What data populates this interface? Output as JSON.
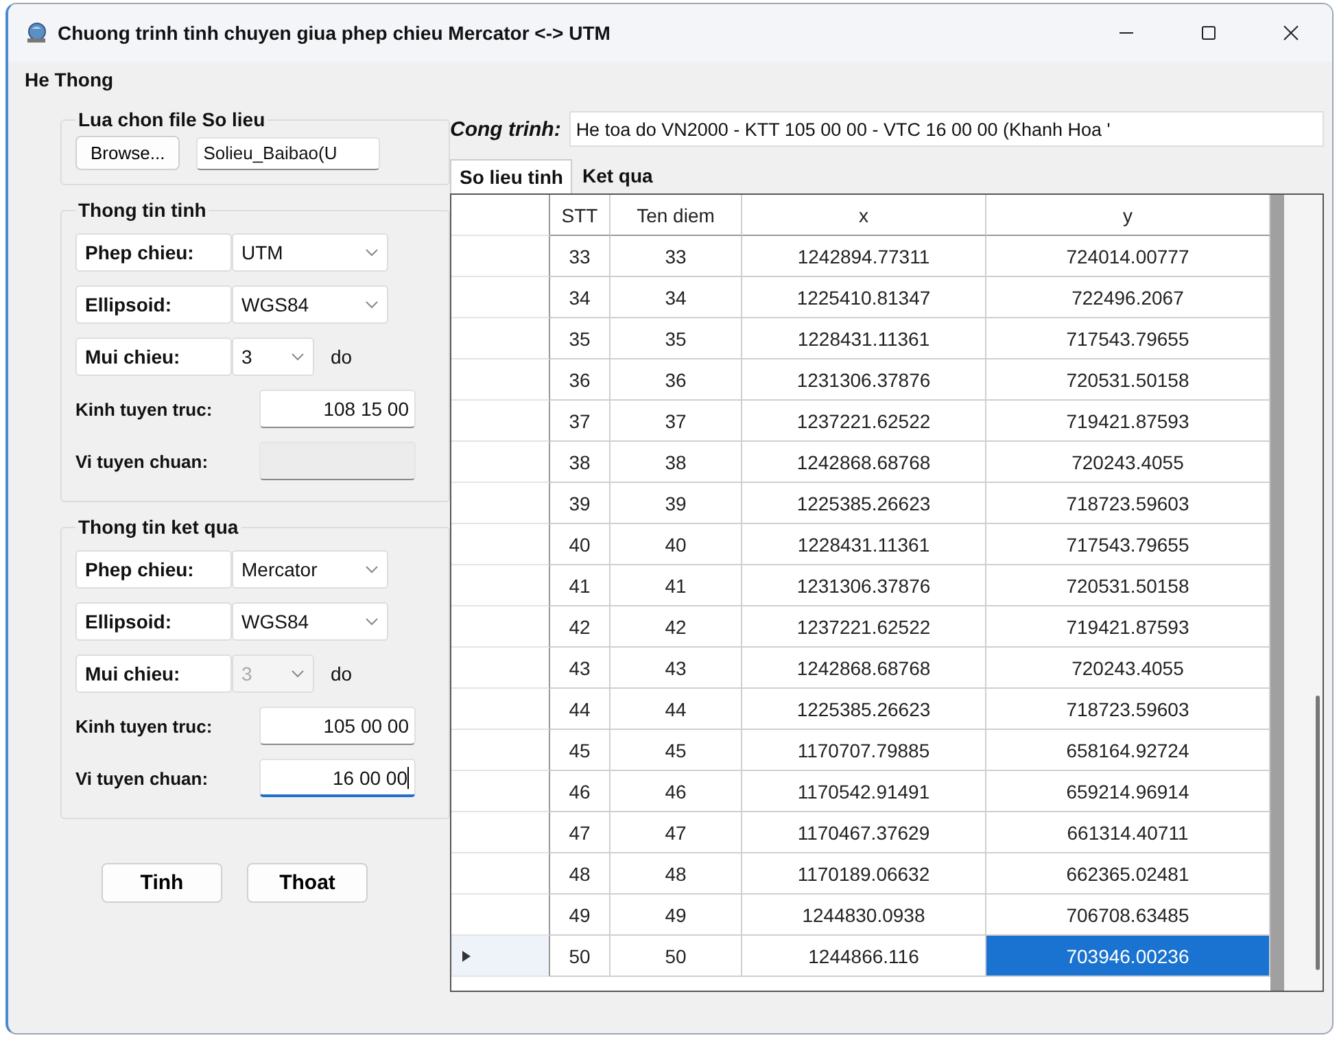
{
  "window": {
    "title": "Chuong trinh tinh chuyen giua phep chieu Mercator <-> UTM"
  },
  "menu": [
    "He Thong"
  ],
  "file_group": {
    "title": "Lua chon file So lieu",
    "button": "Browse...",
    "value": "Solieu_Baibao(U"
  },
  "groups": [
    {
      "title": "Thong tin tinh",
      "fields": [
        {
          "label": "Phep chieu:",
          "kind": "combo",
          "value": "UTM",
          "disabled": false
        },
        {
          "label": "Ellipsoid:",
          "kind": "combo",
          "value": "WGS84",
          "disabled": false
        },
        {
          "label": "Mui chieu:",
          "kind": "combo",
          "value": "3",
          "unit": "do",
          "disabled": false
        },
        {
          "label": "Kinh tuyen truc:",
          "kind": "text",
          "value": "108 15 00",
          "disabled": false,
          "focused": false
        },
        {
          "label": "Vi tuyen chuan:",
          "kind": "text",
          "disabled": true,
          "focused": false
        }
      ]
    },
    {
      "title": "Thong tin ket qua",
      "fields": [
        {
          "label": "Phep chieu:",
          "kind": "combo",
          "value": "Mercator",
          "disabled": false
        },
        {
          "label": "Ellipsoid:",
          "kind": "combo",
          "value": "WGS84",
          "disabled": false
        },
        {
          "label": "Mui chieu:",
          "kind": "combo",
          "value": "3",
          "unit": "do",
          "disabled": true
        },
        {
          "label": "Kinh tuyen truc:",
          "kind": "text",
          "value": "105 00 00",
          "disabled": false,
          "focused": false
        },
        {
          "label": "Vi tuyen chuan:",
          "kind": "text",
          "value": "16 00 00",
          "disabled": false,
          "focused": true
        }
      ]
    }
  ],
  "buttons": [
    "Tinh",
    "Thoat"
  ],
  "project": {
    "label": "Cong trinh:",
    "value": "He toa do VN2000 - KTT 105 00 00 - VTC 16 00 00 (Khanh Hoa '"
  },
  "tabs": [
    {
      "label": "So lieu tinh",
      "selected": true
    },
    {
      "label": "Ket qua",
      "selected": false
    }
  ],
  "table": {
    "columns": [
      "STT",
      "Ten diem",
      "x",
      "y"
    ],
    "rows": [
      {
        "current": false,
        "cells": [
          {
            "text": "33",
            "selected": false
          },
          {
            "text": "33",
            "selected": false
          },
          {
            "text": "1242894.77311",
            "selected": false
          },
          {
            "text": "724014.00777",
            "selected": false
          }
        ]
      },
      {
        "current": false,
        "cells": [
          {
            "text": "34",
            "selected": false
          },
          {
            "text": "34",
            "selected": false
          },
          {
            "text": "1225410.81347",
            "selected": false
          },
          {
            "text": "722496.2067",
            "selected": false
          }
        ]
      },
      {
        "current": false,
        "cells": [
          {
            "text": "35",
            "selected": false
          },
          {
            "text": "35",
            "selected": false
          },
          {
            "text": "1228431.11361",
            "selected": false
          },
          {
            "text": "717543.79655",
            "selected": false
          }
        ]
      },
      {
        "current": false,
        "cells": [
          {
            "text": "36",
            "selected": false
          },
          {
            "text": "36",
            "selected": false
          },
          {
            "text": "1231306.37876",
            "selected": false
          },
          {
            "text": "720531.50158",
            "selected": false
          }
        ]
      },
      {
        "current": false,
        "cells": [
          {
            "text": "37",
            "selected": false
          },
          {
            "text": "37",
            "selected": false
          },
          {
            "text": "1237221.62522",
            "selected": false
          },
          {
            "text": "719421.87593",
            "selected": false
          }
        ]
      },
      {
        "current": false,
        "cells": [
          {
            "text": "38",
            "selected": false
          },
          {
            "text": "38",
            "selected": false
          },
          {
            "text": "1242868.68768",
            "selected": false
          },
          {
            "text": "720243.4055",
            "selected": false
          }
        ]
      },
      {
        "current": false,
        "cells": [
          {
            "text": "39",
            "selected": false
          },
          {
            "text": "39",
            "selected": false
          },
          {
            "text": "1225385.26623",
            "selected": false
          },
          {
            "text": "718723.59603",
            "selected": false
          }
        ]
      },
      {
        "current": false,
        "cells": [
          {
            "text": "40",
            "selected": false
          },
          {
            "text": "40",
            "selected": false
          },
          {
            "text": "1228431.11361",
            "selected": false
          },
          {
            "text": "717543.79655",
            "selected": false
          }
        ]
      },
      {
        "current": false,
        "cells": [
          {
            "text": "41",
            "selected": false
          },
          {
            "text": "41",
            "selected": false
          },
          {
            "text": "1231306.37876",
            "selected": false
          },
          {
            "text": "720531.50158",
            "selected": false
          }
        ]
      },
      {
        "current": false,
        "cells": [
          {
            "text": "42",
            "selected": false
          },
          {
            "text": "42",
            "selected": false
          },
          {
            "text": "1237221.62522",
            "selected": false
          },
          {
            "text": "719421.87593",
            "selected": false
          }
        ]
      },
      {
        "current": false,
        "cells": [
          {
            "text": "43",
            "selected": false
          },
          {
            "text": "43",
            "selected": false
          },
          {
            "text": "1242868.68768",
            "selected": false
          },
          {
            "text": "720243.4055",
            "selected": false
          }
        ]
      },
      {
        "current": false,
        "cells": [
          {
            "text": "44",
            "selected": false
          },
          {
            "text": "44",
            "selected": false
          },
          {
            "text": "1225385.26623",
            "selected": false
          },
          {
            "text": "718723.59603",
            "selected": false
          }
        ]
      },
      {
        "current": false,
        "cells": [
          {
            "text": "45",
            "selected": false
          },
          {
            "text": "45",
            "selected": false
          },
          {
            "text": "1170707.79885",
            "selected": false
          },
          {
            "text": "658164.92724",
            "selected": false
          }
        ]
      },
      {
        "current": false,
        "cells": [
          {
            "text": "46",
            "selected": false
          },
          {
            "text": "46",
            "selected": false
          },
          {
            "text": "1170542.91491",
            "selected": false
          },
          {
            "text": "659214.96914",
            "selected": false
          }
        ]
      },
      {
        "current": false,
        "cells": [
          {
            "text": "47",
            "selected": false
          },
          {
            "text": "47",
            "selected": false
          },
          {
            "text": "1170467.37629",
            "selected": false
          },
          {
            "text": "661314.40711",
            "selected": false
          }
        ]
      },
      {
        "current": false,
        "cells": [
          {
            "text": "48",
            "selected": false
          },
          {
            "text": "48",
            "selected": false
          },
          {
            "text": "1170189.06632",
            "selected": false
          },
          {
            "text": "662365.02481",
            "selected": false
          }
        ]
      },
      {
        "current": false,
        "cells": [
          {
            "text": "49",
            "selected": false
          },
          {
            "text": "49",
            "selected": false
          },
          {
            "text": "1244830.0938",
            "selected": false
          },
          {
            "text": "706708.63485",
            "selected": false
          }
        ]
      },
      {
        "current": true,
        "cells": [
          {
            "text": "50",
            "selected": false
          },
          {
            "text": "50",
            "selected": false
          },
          {
            "text": "1244866.116",
            "selected": false
          },
          {
            "text": "703946.00236",
            "selected": true
          }
        ]
      }
    ]
  }
}
